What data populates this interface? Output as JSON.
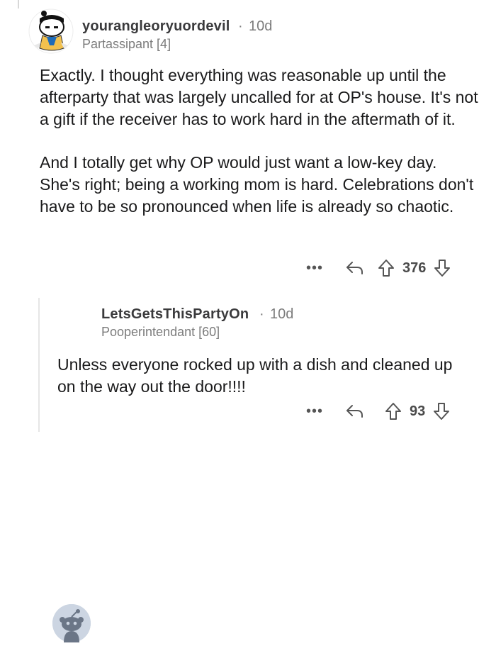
{
  "comments": [
    {
      "username": "yourangleoryuordevil",
      "separator": "·",
      "time": "10d",
      "flair": "Partassipant [4]",
      "paragraphs": [
        "Exactly. I thought everything was reasonable up until the afterparty that was largely uncalled for at OP's house. It's not a gift if the receiver has to work hard in the aftermath of it.",
        "And I totally get why OP would just want a low-key day. She's right; being a working mom is hard. Celebrations don't have to be so pronounced when life is already so chaotic."
      ],
      "score": "376",
      "more_label": "•••"
    },
    {
      "username": "LetsGetsThisPartyOn",
      "separator": "·",
      "time": "10d",
      "flair": "Pooperintendant [60]",
      "paragraphs": [
        "Unless everyone rocked up with a dish and cleaned up on the way out the door!!!!"
      ],
      "score": "93",
      "more_label": "•••"
    }
  ],
  "icons": {
    "reply": "reply-arrow-icon",
    "upvote": "upvote-arrow-icon",
    "downvote": "downvote-arrow-icon"
  },
  "colors": {
    "text": "#1a1a1b",
    "meta": "#7c7c7c",
    "thread_line": "#e6e6e6",
    "snoo_avatar_bg": "#ccd5e2"
  }
}
